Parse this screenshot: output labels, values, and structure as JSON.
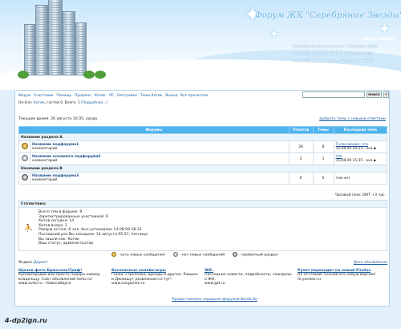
{
  "header": {
    "title": "Форум ЖК \"Серебряные Звезды\"",
    "news_heading": "НАШИ ССЫЛКИ",
    "news": [
      "«Серебряный источник» - Квартал 5/5/5",
      "«Серебряный дождь» - Квартал 3/5/6",
      "«Серебряный ключ» - Сургутский Бор"
    ]
  },
  "nav": [
    "Форум",
    "Участники",
    "Помощь",
    "Профиль",
    "Котик",
    "ЛС",
    "Настройки",
    "Темы Котик",
    "Выход",
    "Все прочитано"
  ],
  "search": {
    "button": "поиск",
    "plus": "+"
  },
  "userline": {
    "prefix": "On-line: ",
    "user": "Котик",
    "suffix": ", гостей 0. Всего: 1",
    "more": "[Подробнее...]"
  },
  "time_line": "Текущее время: 26 августа 10:35, среда",
  "unread_link": "выбрать темы с новыми ответами",
  "table": {
    "headers": [
      "Форумы",
      "Ответов",
      "Темы",
      "Последняя тема"
    ],
    "sections": [
      {
        "name": "Название раздела A",
        "forums": [
          {
            "name": "Название подфорума1",
            "desc": "комментарий",
            "answers": "26",
            "topics": "8",
            "last_topic": "Голосование: что",
            "last_info": "15.08.09 20:23 · ava",
            "icon": "new"
          },
          {
            "name": "Название основного подфорума6",
            "desc": "комментарий",
            "answers": "2",
            "topics": "1",
            "last_topic": "тоо",
            "last_info": "15.08.09 15:35 · ava",
            "icon": "old"
          }
        ]
      },
      {
        "name": "Название раздела B",
        "forums": [
          {
            "name": "Название подфорума3",
            "desc": "комментарий",
            "answers": "0",
            "topics": "0",
            "last_topic": "тем нет",
            "last_info": "",
            "icon": "lock"
          }
        ]
      }
    ]
  },
  "gmt": "Часовой пояс GMT +3 час.",
  "stats": {
    "title": "Статистика:",
    "lines": [
      "Всего тем в форуме: 9",
      "Зарегистрированных участников: 6",
      "Хитов сегодня: 14",
      "Хитов вчера: 1",
      "Рекорд on-line: 6 чел. был установлен 14.08.09 18:33",
      "Последний раз Вы заходили: 14 августа 05:57, пятница",
      "Вы зашли как: Котик",
      "Ваш статус: администратор"
    ]
  },
  "legend": [
    "- есть новые сообщения",
    "- нет новых сообщений",
    "- приватный раздел"
  ],
  "ads": {
    "label": "Яндекс.",
    "label_link": "Директ",
    "give": "Дать объявление",
    "items": [
      {
        "title": "Щенки фото Брюссель/Гриф!",
        "text": "Куплю/продай или просто подари новому владельцу. Сайт объявлений Avito.ru!",
        "url": "www.avito.ru · Новосибирск"
      },
      {
        "title": "Бесплатные онлайн-игры",
        "text": "Гонки, стрелялки, аркады и другие. Равшан и Джамшут развлекаются тут!",
        "url": "www.ourgames.ru"
      },
      {
        "title": "ЖК.",
        "text": "Последние новости, подробности, скандалы о ЖК.",
        "url": "www.gzt.ru"
      },
      {
        "title": "Рунет переходит на новый Firefox",
        "text": "Не отставай! Скачай его новую версию!",
        "url": "fx.yandex.ru"
      }
    ]
  },
  "footer": "Предоставлено сервисом форумов Borda.Ru",
  "watermark": "4-dp2ign.ru"
}
